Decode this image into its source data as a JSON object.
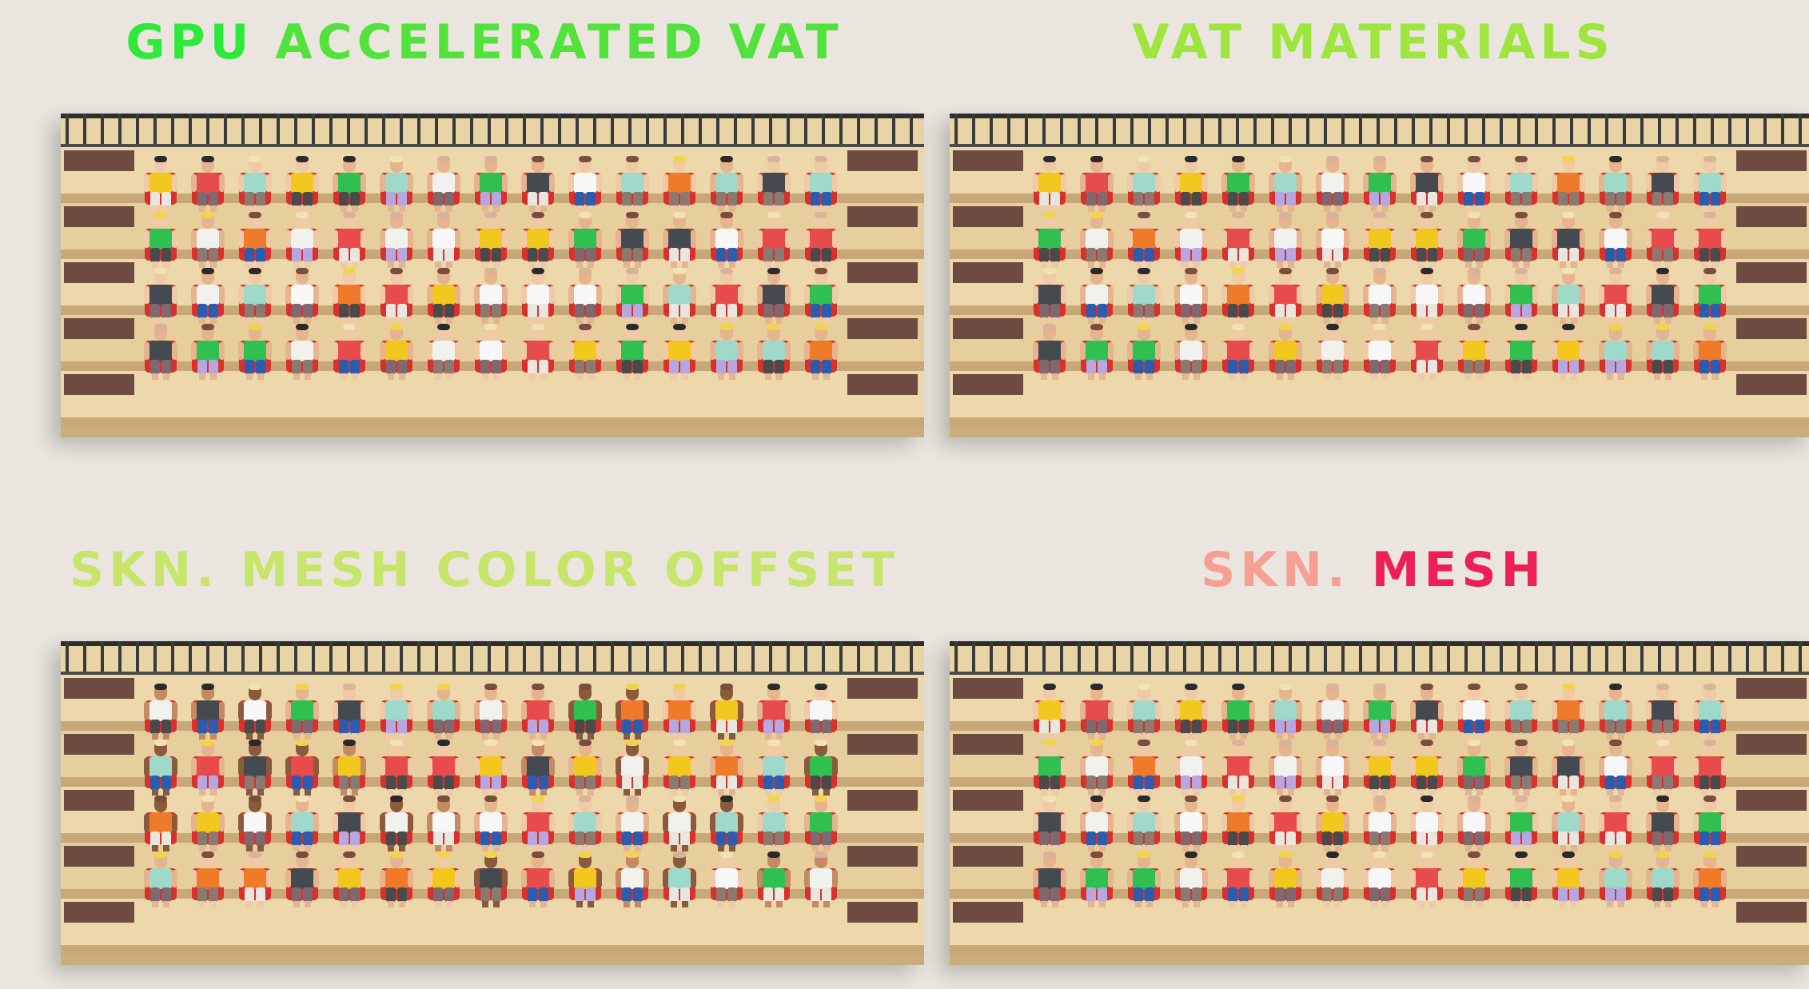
{
  "panels": [
    {
      "title_parts": [
        {
          "text": "GPU ",
          "color": "#2ee83a"
        },
        {
          "text": "ACCELERATED VAT",
          "color": "#52e23c"
        }
      ],
      "gradient": [
        "#1fe33c",
        "#7bdc3e"
      ],
      "crowd_variant": "vat"
    },
    {
      "title_parts": [
        {
          "text": "VAT MATERIALS",
          "color": "#9ee63e"
        }
      ],
      "gradient": [
        "#8fe33f",
        "#c4e83a"
      ],
      "crowd_variant": "vat"
    },
    {
      "title_parts": [
        {
          "text": "SKN. MESH COLOR OFFSET",
          "color": "#c7e56a"
        }
      ],
      "gradient": [
        "#b8ef5a",
        "#f9a98f"
      ],
      "crowd_variant": "offset"
    },
    {
      "title_parts": [
        {
          "text": "SKN. ",
          "color": "#f5a093"
        },
        {
          "text": "MESH",
          "color": "#ee1f55"
        }
      ],
      "gradient": [
        "#f5a093",
        "#ee1f55"
      ],
      "crowd_variant": "vat"
    }
  ],
  "shirt_colors": [
    "#f1f1ee",
    "#e84b4b",
    "#2fc04f",
    "#f2c81e",
    "#444a4f",
    "#ef7a2a",
    "#9fd9c9",
    "#f7f7f7"
  ],
  "pant_colors": [
    "#7e6a6e",
    "#2e5cad",
    "#b6a7de",
    "#e9e5df",
    "#4a4a4a",
    "#8a7a70"
  ],
  "skin_colors": [
    "#f0c9a6",
    "#e6b48f",
    "#c58a63",
    "#8a5a3c"
  ],
  "hair_colors": [
    "#f2e3b2",
    "#7a4e3c",
    "#2a2a2a",
    "#f2d34c",
    "#d7b39a"
  ]
}
